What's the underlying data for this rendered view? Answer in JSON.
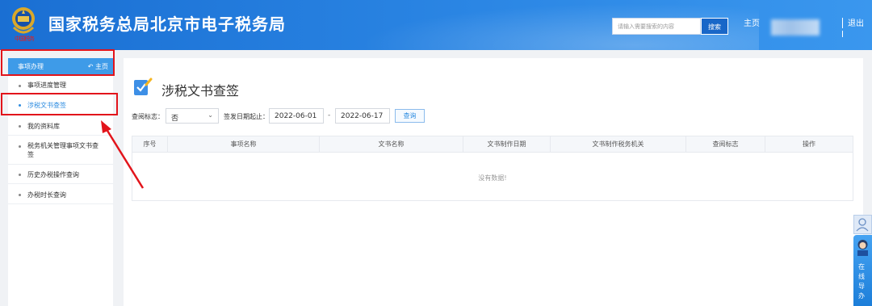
{
  "header": {
    "site_title": "国家税务总局北京市电子税务局",
    "emblem_text": "中国税务",
    "search_placeholder": "请输入需要搜索的内容",
    "search_button": "搜索",
    "home_link": "主页",
    "logout_label": "退出"
  },
  "sidebar": {
    "title": "事项办理",
    "home_label": "主页",
    "items": [
      {
        "label": "事项进度管理",
        "active": false
      },
      {
        "label": "涉税文书查签",
        "active": true
      },
      {
        "label": "我的资料库",
        "active": false
      },
      {
        "label": "税务机关管理事项文书查签",
        "active": false
      },
      {
        "label": "历史办税操作查询",
        "active": false
      },
      {
        "label": "办税时长查询",
        "active": false
      }
    ]
  },
  "main": {
    "title": "涉税文书查签",
    "filters": {
      "check_label": "查阅标志：",
      "check_value": "否",
      "date_label": "签发日期起止：",
      "date_start": "2022-06-01",
      "date_end": "2022-06-17",
      "query_button": "查询"
    },
    "table": {
      "columns": [
        "序号",
        "事项名称",
        "文书名称",
        "文书制作日期",
        "文书制作税务机关",
        "查阅标志",
        "操作"
      ],
      "empty_text": "没有数据!"
    }
  },
  "float_widget": {
    "label": "在线导办"
  },
  "colors": {
    "header_blue": "#1a6fd3",
    "accent_blue": "#2d8ce0",
    "annotation_red": "#e2141b"
  }
}
